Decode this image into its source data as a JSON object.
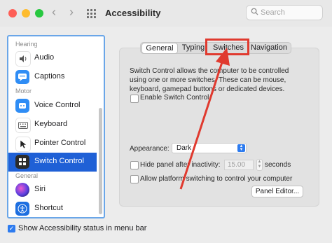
{
  "window": {
    "title": "Accessibility"
  },
  "search": {
    "placeholder": "Search"
  },
  "sidebar": {
    "section_hearing": "Hearing",
    "section_motor": "Motor",
    "section_general": "General",
    "items": [
      {
        "label": "Audio",
        "icon": "speaker-icon"
      },
      {
        "label": "Captions",
        "icon": "captions-icon"
      },
      {
        "label": "Voice Control",
        "icon": "voice-control-icon"
      },
      {
        "label": "Keyboard",
        "icon": "keyboard-icon"
      },
      {
        "label": "Pointer Control",
        "icon": "pointer-icon"
      },
      {
        "label": "Switch Control",
        "icon": "switch-control-icon",
        "selected": true
      },
      {
        "label": "Siri",
        "icon": "siri-icon"
      },
      {
        "label": "Shortcut",
        "icon": "accessibility-shortcut-icon"
      }
    ]
  },
  "tabs": [
    "General",
    "Typing",
    "Switches",
    "Navigation"
  ],
  "active_tab": "General",
  "highlighted_tab": "Switches",
  "main": {
    "description": "Switch Control allows the computer to be controlled using one or more switches. These can be mouse, keyboard, gamepad buttons or dedicated devices.",
    "enable_label": "Enable Switch Control",
    "appearance_label": "Appearance:",
    "appearance_value": "Dark",
    "hide_panel_label": "Hide panel after inactivity:",
    "hide_panel_value": "15.00",
    "seconds_label": "seconds",
    "platform_label": "Allow platform switching to control your computer",
    "panel_editor_label": "Panel Editor..."
  },
  "footer": {
    "status_label": "Show Accessibility status in menu bar",
    "status_checked": true
  },
  "colors": {
    "selection": "#1f60d6",
    "annotation": "#e03a2f",
    "accent": "#2d7bef"
  }
}
